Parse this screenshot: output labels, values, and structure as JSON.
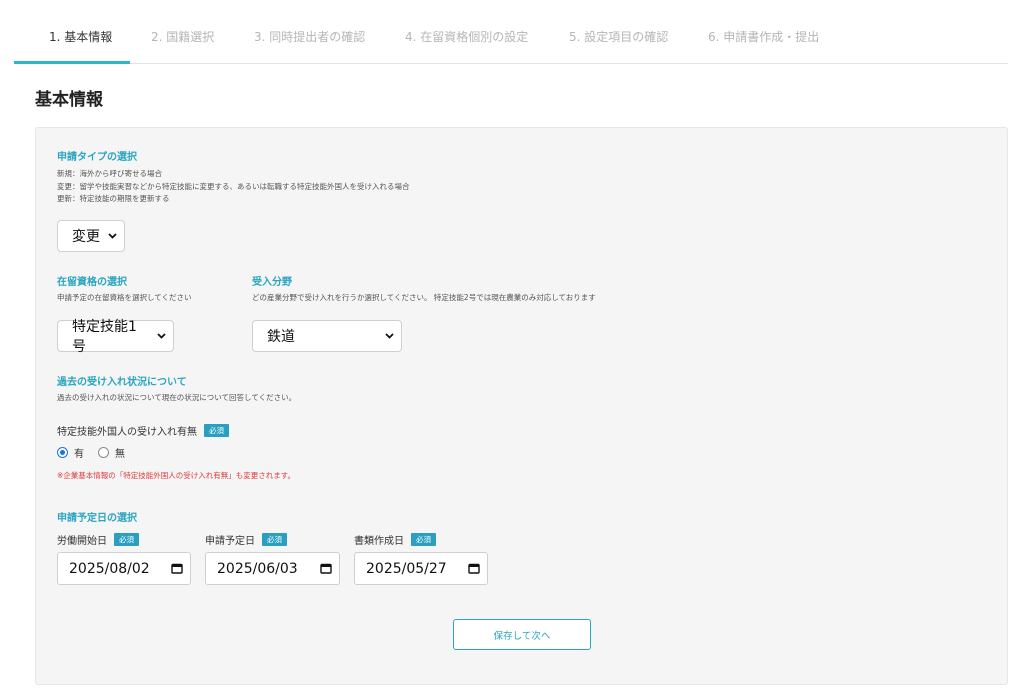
{
  "steps": [
    {
      "label": "1. 基本情報"
    },
    {
      "label": "2. 国籍選択"
    },
    {
      "label": "3. 同時提出者の確認"
    },
    {
      "label": "4. 在留資格個別の設定"
    },
    {
      "label": "5. 設定項目の確認"
    },
    {
      "label": "6. 申請書作成・提出"
    }
  ],
  "active_step": 1,
  "page_title": "基本情報",
  "application_type": {
    "title": "申請タイプの選択",
    "notes": [
      "新規：海外から呼び寄せる場合",
      "変更：留学や技能実習などから特定技能に変更する、あるいは転職する特定技能外国人を受け入れる場合",
      "更新：特定技能の期限を更新する"
    ],
    "selected": "変更"
  },
  "status_of_residence": {
    "title": "在留資格の選択",
    "note": "申請予定の在留資格を選択してください",
    "selected": "特定技能1号"
  },
  "field": {
    "title": "受入分野",
    "note": "どの産業分野で受け入れを行うか選択してください。 特定技能2号では現在農業のみ対応しております",
    "selected": "鉄道"
  },
  "past_acceptance": {
    "title": "過去の受け入れ状況について",
    "note": "過去の受け入れの状況について現在の状況について回答してください。",
    "question": "特定技能外国人の受け入れ有無",
    "required_badge": "必須",
    "options": [
      {
        "label": "有",
        "checked": true
      },
      {
        "label": "無",
        "checked": false
      }
    ],
    "warning": "※企業基本情報の「特定技能外国人の受け入れ有無」も変更されます。"
  },
  "schedule": {
    "title": "申請予定日の選択",
    "fields": [
      {
        "label": "労働開始日",
        "badge": "必須",
        "value": "2025/08/02"
      },
      {
        "label": "申請予定日",
        "badge": "必須",
        "value": "2025/06/03"
      },
      {
        "label": "書類作成日",
        "badge": "必須",
        "value": "2025/05/27"
      }
    ]
  },
  "save_button": "保存して次へ",
  "colors": {
    "accent": "#2aa5c0",
    "warning": "#e0393e",
    "radio": "#1a73e8"
  }
}
